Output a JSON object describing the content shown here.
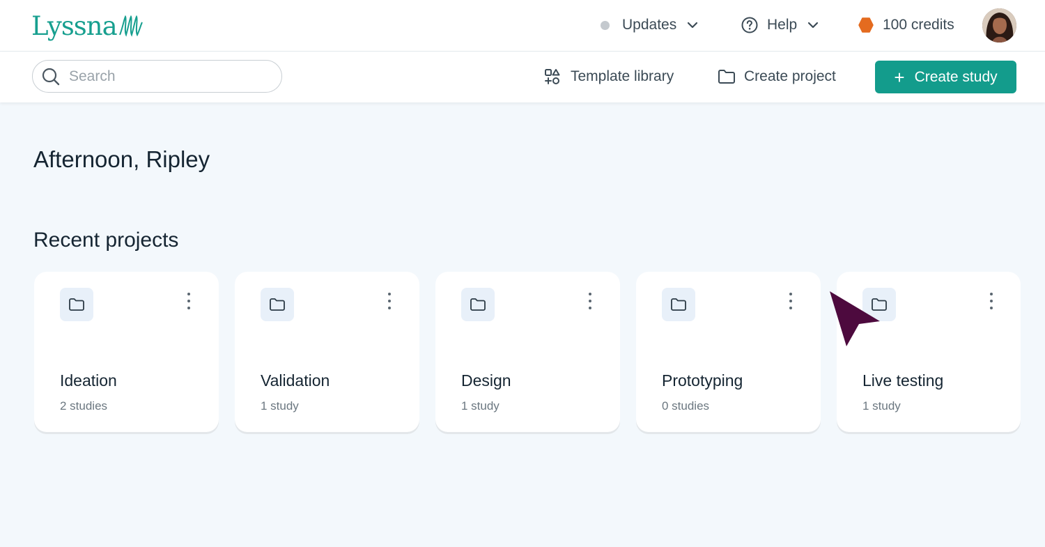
{
  "brand": {
    "name": "Lyssna",
    "accent": "#139c8c"
  },
  "topbar": {
    "updates_label": "Updates",
    "help_label": "Help",
    "credits_label": "100 credits"
  },
  "toolbar": {
    "search_placeholder": "Search",
    "template_library_label": "Template library",
    "create_project_label": "Create project",
    "create_study_label": "Create study"
  },
  "main": {
    "greeting": "Afternoon, Ripley",
    "recent_projects_title": "Recent projects",
    "projects": [
      {
        "name": "Ideation",
        "count": "2 studies"
      },
      {
        "name": "Validation",
        "count": "1 study"
      },
      {
        "name": "Design",
        "count": "1 study"
      },
      {
        "name": "Prototyping",
        "count": "0 studies"
      },
      {
        "name": "Live testing",
        "count": "1 study"
      }
    ]
  },
  "icons": [
    "search-icon",
    "chevron-down-icon",
    "help-circle-icon",
    "credits-hexagon-icon",
    "template-icon",
    "folder-icon",
    "plus-icon",
    "kebab-menu-icon",
    "mouse-cursor-icon"
  ]
}
